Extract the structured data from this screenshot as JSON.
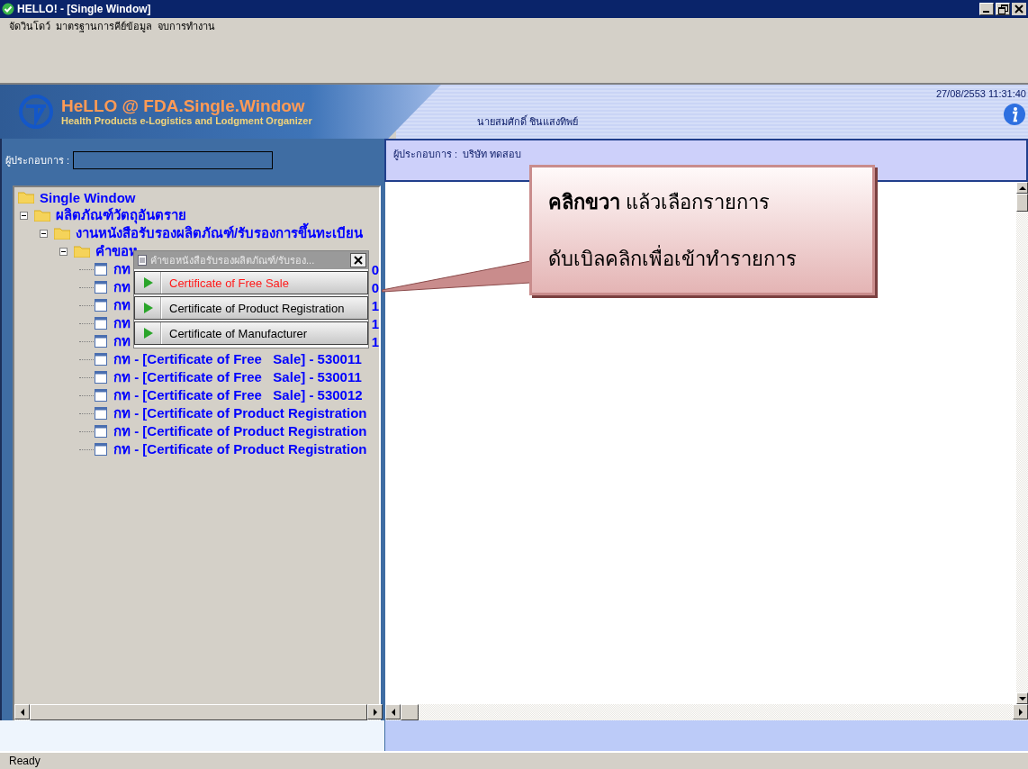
{
  "window": {
    "title": "HELLO! - [Single Window]"
  },
  "menu": [
    "จัดวินโดว์",
    "มาตรฐานการคีย์ข้อมูล",
    "จบการทำงาน"
  ],
  "banner": {
    "logo_title": "HeLLO @ FDA.Single.Window",
    "logo_subtitle": "Health Products e-Logistics and Lodgment Organizer",
    "user": "นายสมศักดิ์ ชินแสงทิพย์",
    "datetime": "27/08/2553 11:31:40"
  },
  "operator_search": {
    "label": "ผู้ประกอบการ :"
  },
  "operator_info": {
    "label": "ผู้ประกอบการ :",
    "value": "บริษัท ทดสอบ"
  },
  "tree": [
    {
      "kind": "folder",
      "label": "Single Window",
      "children": [
        {
          "kind": "folder",
          "label": "ผลิตภัณฑ์วัตถุอันตราย",
          "expanded": true,
          "children": [
            {
              "kind": "folder",
              "label": "งานหนังสือรับรองผลิตภัณฑ์/รับรองการขึ้นทะเบียน",
              "expanded": true,
              "children": [
                {
                  "kind": "folder",
                  "label": "คำขอห",
                  "expanded": true,
                  "children": [
                    {
                      "kind": "document",
                      "label": "กท",
                      "tail": "0"
                    },
                    {
                      "kind": "document",
                      "label": "กท",
                      "tail": "0"
                    },
                    {
                      "kind": "document",
                      "label": "กท",
                      "tail": "1"
                    },
                    {
                      "kind": "document",
                      "label": "กท",
                      "tail": "1"
                    },
                    {
                      "kind": "document",
                      "label": "กท",
                      "tail": "1"
                    },
                    {
                      "kind": "document",
                      "label": "กท - [Certificate of Free   Sale] - 530011"
                    },
                    {
                      "kind": "document",
                      "label": "กท - [Certificate of Free   Sale] - 530011"
                    },
                    {
                      "kind": "document",
                      "label": "กท - [Certificate of Free   Sale] - 530012"
                    },
                    {
                      "kind": "document",
                      "label": "กท - [Certificate of Product Registration"
                    },
                    {
                      "kind": "document",
                      "label": "กท - [Certificate of Product Registration"
                    },
                    {
                      "kind": "document",
                      "label": "กท - [Certificate of Product Registration"
                    }
                  ]
                }
              ]
            }
          ]
        }
      ]
    }
  ],
  "popup": {
    "title": "คำขอหนังสือรับรองผลิตภัณฑ์/รับรอง...",
    "items": [
      {
        "label": "Certificate of Free Sale",
        "selected": true
      },
      {
        "label": "Certificate of Product Registration",
        "selected": false
      },
      {
        "label": "Certificate of Manufacturer",
        "selected": false
      }
    ]
  },
  "callout": {
    "lines": [
      "**คลิกขวา** แล้วเลือกรายการ",
      "ดับเบิลคลิกเพื่อเข้าทำรายการ"
    ]
  },
  "status_bar": {
    "text": "Ready"
  }
}
